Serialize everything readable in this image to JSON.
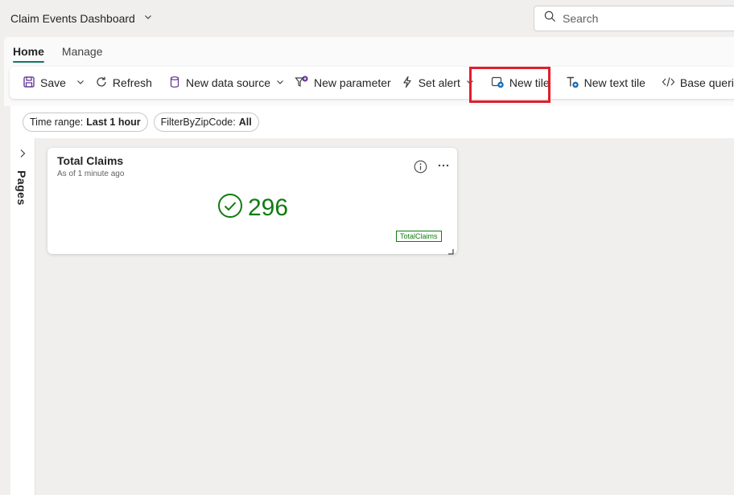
{
  "header": {
    "title": "Claim Events Dashboard",
    "search_placeholder": "Search"
  },
  "tabs": [
    {
      "label": "Home",
      "active": true
    },
    {
      "label": "Manage",
      "active": false
    }
  ],
  "toolbar": {
    "save": "Save",
    "refresh": "Refresh",
    "new_data_source": "New data source",
    "new_parameter": "New parameter",
    "set_alert": "Set alert",
    "new_tile": "New tile",
    "new_text_tile": "New text tile",
    "base_queries": "Base queries"
  },
  "filters": [
    {
      "label": "Time range:",
      "value": "Last 1 hour"
    },
    {
      "label": "FilterByZipCode:",
      "value": "All"
    }
  ],
  "pages_rail": {
    "label": "Pages"
  },
  "tile": {
    "title": "Total Claims",
    "subtitle": "As of 1 minute ago",
    "value": "296",
    "query_tag": "TotalClaims"
  },
  "colors": {
    "accent": "#117865",
    "success": "#107c10",
    "highlight_border": "#e01e2b",
    "icon_purple": "#5c2e91"
  }
}
